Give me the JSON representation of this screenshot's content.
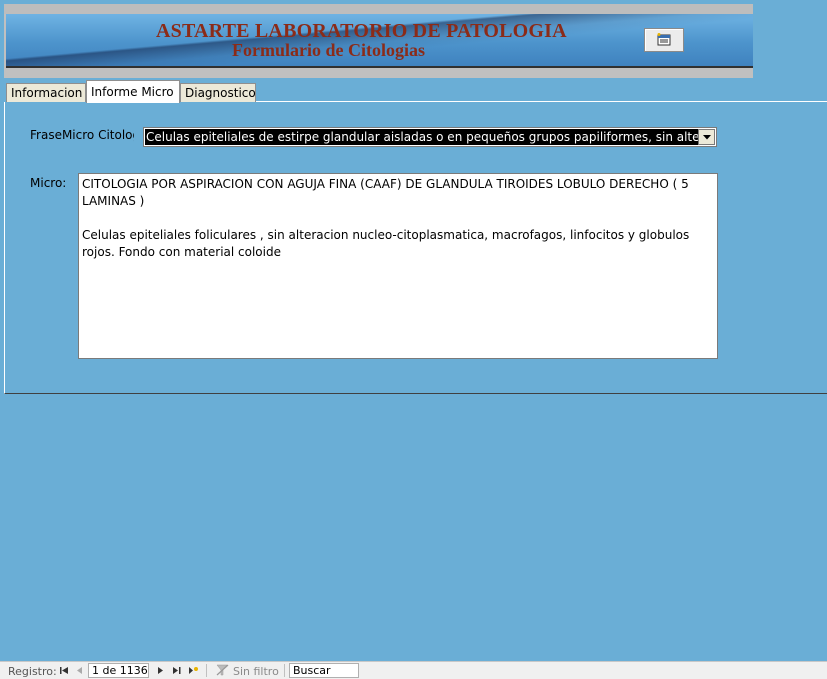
{
  "header": {
    "title": "ASTARTE LABORATORIO DE PATOLOGIA",
    "subtitle": "Formulario de Citologias",
    "report_button_icon": "report-icon"
  },
  "tabs": [
    {
      "label": "Informacion",
      "active": false
    },
    {
      "label": "Informe Micro",
      "active": true
    },
    {
      "label": "Diagnostico",
      "active": false
    }
  ],
  "form": {
    "frase_label": "FraseMicro Citolog",
    "frase_value": "Celulas epiteliales de estirpe glandular aisladas o en pequeños grupos papiliformes, sin alteracion",
    "micro_label": "Micro:",
    "micro_paragraphs": [
      "CITOLOGIA POR ASPIRACION CON AGUJA FINA (CAAF) DE GLANDULA TIROIDES LOBULO DERECHO  ( 5 LAMINAS )",
      "Celulas epiteliales foliculares , sin alteracion nucleo-citoplasmatica, macrofagos, linfocitos  y globulos rojos. Fondo con material coloide"
    ]
  },
  "navigation": {
    "label": "Registro:",
    "record": "1 de 1136",
    "filter": "Sin filtro",
    "search": "Buscar"
  },
  "colors": {
    "background": "#6aaed6",
    "title": "#8b2b18",
    "selection": "#000000"
  }
}
